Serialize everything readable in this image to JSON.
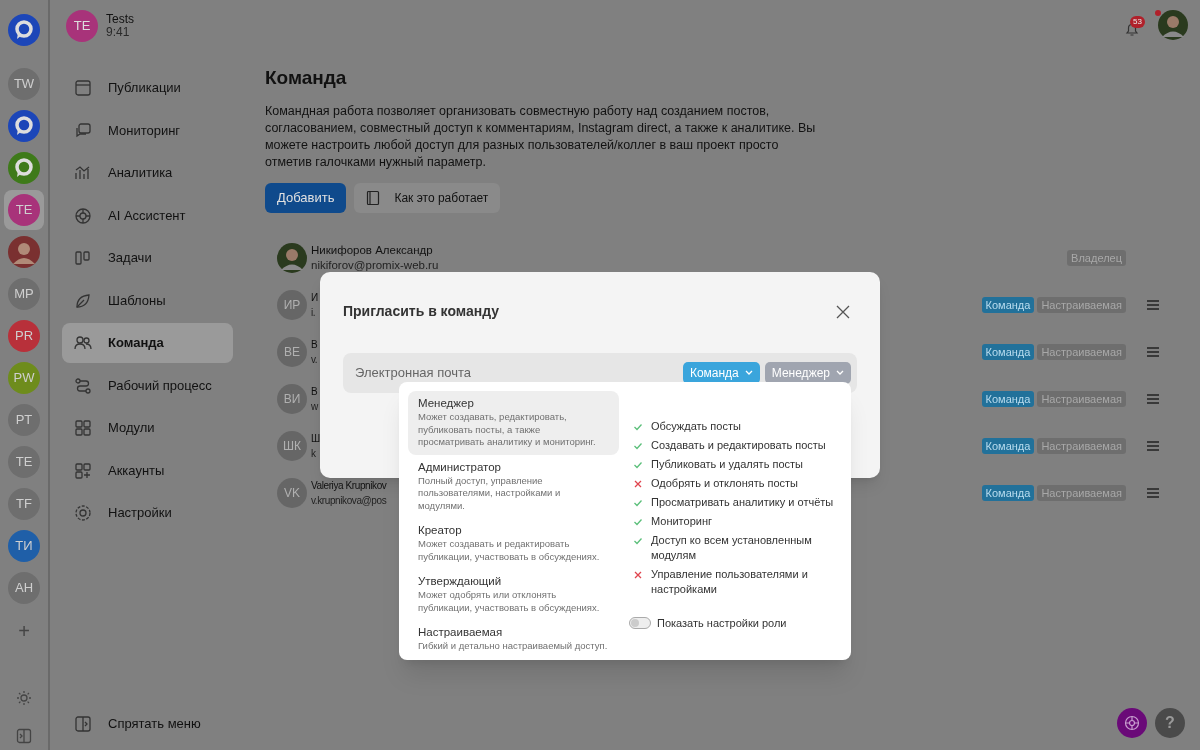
{
  "rail": {
    "accounts": [
      {
        "kind": "logo",
        "color": "#1c46b8",
        "selected": false
      },
      {
        "kind": "initials",
        "initials": "TW",
        "color": "#6e6e6e",
        "selected": false
      },
      {
        "kind": "logo",
        "color": "#1c46b8",
        "selected": false
      },
      {
        "kind": "logo",
        "color": "#3e7a1a",
        "selected": false
      },
      {
        "kind": "initials",
        "initials": "TE",
        "color": "#a8337a",
        "selected": true
      },
      {
        "kind": "photo",
        "color": "#7a3030",
        "selected": false
      },
      {
        "kind": "initials",
        "initials": "MP",
        "color": "#6e6e6e",
        "selected": false
      },
      {
        "kind": "initials",
        "initials": "PR",
        "color": "#b8303a",
        "selected": false
      },
      {
        "kind": "initials",
        "initials": "PW",
        "color": "#6e8c1c",
        "selected": false
      },
      {
        "kind": "initials",
        "initials": "PT",
        "color": "#6e6e6e",
        "selected": false
      },
      {
        "kind": "initials",
        "initials": "TE",
        "color": "#6e6e6e",
        "selected": false
      },
      {
        "kind": "initials",
        "initials": "TF",
        "color": "#6e6e6e",
        "selected": false
      },
      {
        "kind": "initials",
        "initials": "ТИ",
        "color": "#1f5fa8",
        "selected": false
      },
      {
        "kind": "initials",
        "initials": "AH",
        "color": "#6e6e6e",
        "selected": false
      }
    ],
    "add": "+"
  },
  "profile": {
    "initials": "TE",
    "name": "Tests",
    "time": "9:41"
  },
  "nav": [
    {
      "label": "Публикации",
      "selected": false
    },
    {
      "label": "Мониторинг",
      "selected": false
    },
    {
      "label": "Аналитика",
      "selected": false
    },
    {
      "label": "AI Ассистент",
      "selected": false
    },
    {
      "label": "Задачи",
      "selected": false
    },
    {
      "label": "Шаблоны",
      "selected": false
    },
    {
      "label": "Команда",
      "selected": true
    },
    {
      "label": "Рабочий процесс",
      "selected": false
    },
    {
      "label": "Модули",
      "selected": false
    },
    {
      "label": "Аккаунты",
      "selected": false
    },
    {
      "label": "Настройки",
      "selected": false
    }
  ],
  "hide_menu": "Спрятать меню",
  "header": {
    "notifications": "53"
  },
  "page": {
    "title": "Команда",
    "description": "Командная работа позволяет организовать совместную работу над созданием постов, согласованием, совместный доступ к комментариям, Instagram direct, а также к аналитике. Вы можете настроить любой доступ для разных пользователей/коллег в ваш проект просто отметив галочками нужный параметр.",
    "add_button": "Добавить",
    "how_button": "Как это работает"
  },
  "members": [
    {
      "kind": "photo",
      "name": "Никифоров Александр",
      "email": "nikiforov@promix-web.ru",
      "tags": [
        {
          "kind": "owner",
          "label": "Владелец"
        }
      ]
    },
    {
      "kind": "initials",
      "initials": "ИР",
      "name": "И",
      "email": "i.",
      "tags": [
        {
          "kind": "team",
          "label": "Команда"
        },
        {
          "kind": "role",
          "label": "Настраиваемая"
        }
      ]
    },
    {
      "kind": "initials",
      "initials": "ВЕ",
      "name": "В",
      "email": "v.",
      "tags": [
        {
          "kind": "team",
          "label": "Команда"
        },
        {
          "kind": "role",
          "label": "Настраиваемая"
        }
      ]
    },
    {
      "kind": "initials",
      "initials": "ВИ",
      "name": "В",
      "email": "w",
      "tags": [
        {
          "kind": "team",
          "label": "Команда"
        },
        {
          "kind": "role",
          "label": "Настраиваемая"
        }
      ]
    },
    {
      "kind": "initials",
      "initials": "ШК",
      "name": "Ш",
      "email": "k",
      "tags": [
        {
          "kind": "team",
          "label": "Команда"
        },
        {
          "kind": "role",
          "label": "Настраиваемая"
        }
      ]
    },
    {
      "kind": "initials",
      "initials": "VK",
      "name": "Valeriya Krupnikov",
      "email": "v.krupnikova@pos",
      "tags": [
        {
          "kind": "team",
          "label": "Команда"
        },
        {
          "kind": "role",
          "label": "Настраиваемая"
        }
      ]
    }
  ],
  "modal": {
    "title": "Пригласить в команду",
    "email_placeholder": "Электронная почта",
    "team_select": "Команда",
    "role_select": "Менеджер",
    "roles": [
      {
        "name": "Менеджер",
        "description": "Может создавать, редактировать, публиковать посты, а также просматривать аналитику и мониторинг.",
        "selected": true
      },
      {
        "name": "Администратор",
        "description": "Полный доступ, управление пользователями, настройками и модулями.",
        "selected": false
      },
      {
        "name": "Креатор",
        "description": "Может создавать и редактировать публикации, участвовать в обсуждениях.",
        "selected": false
      },
      {
        "name": "Утверждающий",
        "description": "Может одобрять или отклонять публикации, участвовать в обсуждениях.",
        "selected": false
      },
      {
        "name": "Настраиваемая",
        "description": "Гибкий и детально настраиваемый доступ.",
        "selected": false
      }
    ],
    "permissions": [
      {
        "label": "Обсуждать посты",
        "allowed": true
      },
      {
        "label": "Создавать и редактировать посты",
        "allowed": true
      },
      {
        "label": "Публиковать и удалять посты",
        "allowed": true
      },
      {
        "label": "Одобрять и отклонять посты",
        "allowed": false
      },
      {
        "label": "Просматривать аналитику и отчёты",
        "allowed": true
      },
      {
        "label": "Мониторинг",
        "allowed": true
      },
      {
        "label": "Доступ ко всем установленным модулям",
        "allowed": true
      },
      {
        "label": "Управление пользователями и настройками",
        "allowed": false
      }
    ],
    "toggle": {
      "label": "Показать настройки роли",
      "on": false
    }
  },
  "help": "?"
}
